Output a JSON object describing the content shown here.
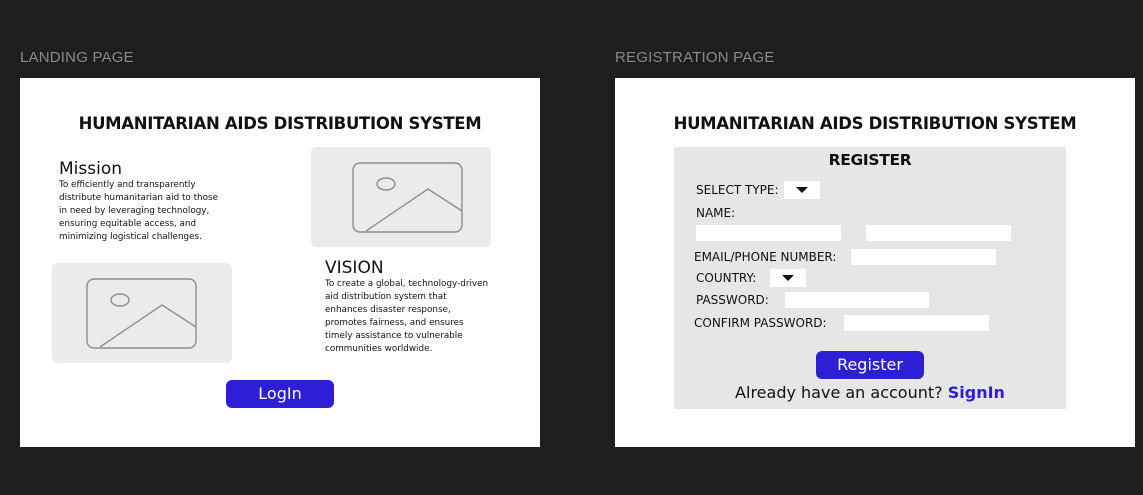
{
  "landing": {
    "frame_label": "LANDING PAGE",
    "title": "HUMANITARIAN AIDS DISTRIBUTION SYSTEM",
    "mission_heading": "Mission",
    "mission_lines": [
      "To efficiently and transparently",
      "distribute humanitarian aid to those",
      "in need by leveraging technology,",
      "ensuring equitable access, and",
      "minimizing logistical challenges."
    ],
    "vision_heading": "VISION",
    "vision_lines": [
      "To create a global, technology-driven",
      "aid distribution system that",
      "enhances disaster response,",
      "promotes fairness, and ensures",
      "timely assistance to vulnerable",
      "communities worldwide."
    ],
    "login_label": "LogIn"
  },
  "registration": {
    "frame_label": "REGISTRATION PAGE",
    "title": "HUMANITARIAN AIDS DISTRIBUTION SYSTEM",
    "form_title": "REGISTER",
    "select_type_label": "SELECT TYPE:",
    "name_label": "NAME:",
    "email_label": "EMAIL/PHONE NUMBER:",
    "country_label": "COUNTRY:",
    "password_label": "PASSWORD:",
    "confirm_password_label": "CONFIRM PASSWORD:",
    "register_label": "Register",
    "account_prompt": "Already have an account?",
    "signin_label": "SignIn"
  },
  "colors": {
    "background": "#1e1e1e",
    "accent": "#2c1fd6",
    "signin_link": "#2c1fd6",
    "panel": "#e6e6e6",
    "placeholder": "#ebebeb"
  },
  "icons": [
    "image-placeholder-icon",
    "dropdown-arrow-icon"
  ]
}
